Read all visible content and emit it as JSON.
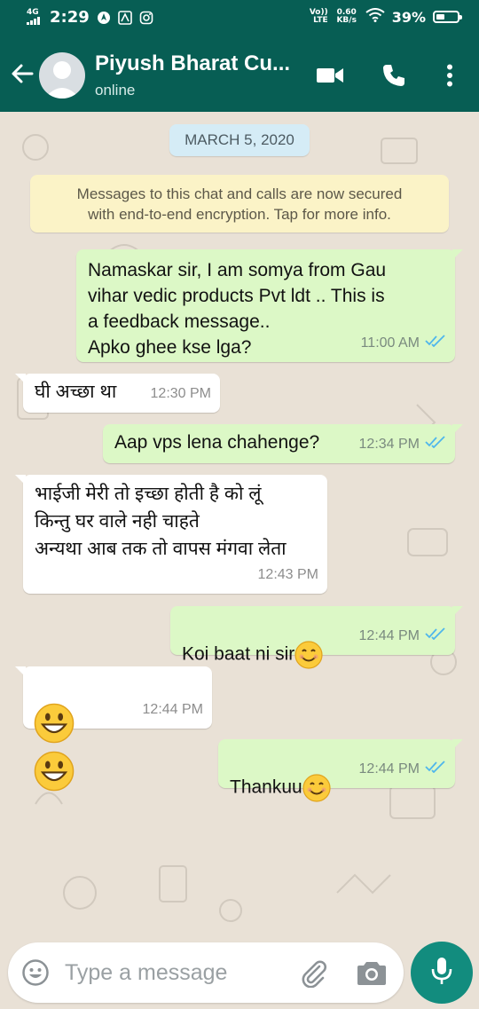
{
  "status_bar": {
    "network": "4G",
    "time": "2:29",
    "carrier": "Vo)) LTE",
    "speed": "0.60 KB/s",
    "battery_percent": "39%",
    "battery_level": 0.39
  },
  "header": {
    "contact_name": "Piyush Bharat Cu...",
    "status": "online",
    "icons": [
      "back-arrow-icon",
      "avatar",
      "video-call-icon",
      "phone-icon",
      "more-options-icon"
    ]
  },
  "chat": {
    "date_label": "MARCH 5, 2020",
    "encryption_notice": "Messages to this chat and calls are now secured\nwith end-to-end encryption. Tap for more info.",
    "messages": [
      {
        "direction": "out",
        "text": "Namaskar sir, I am somya from Gau\nvihar vedic products Pvt ldt .. This is\na feedback message..\nApko ghee kse lga?",
        "time": "11:00 AM",
        "read": true
      },
      {
        "direction": "in",
        "text": "घी अच्छा था",
        "time": "12:30 PM"
      },
      {
        "direction": "out",
        "text": "Aap vps lena chahenge?",
        "time": "12:34 PM",
        "read": true
      },
      {
        "direction": "in",
        "text": "भाईजी मेरी तो इच्छा होती है को लूं\nकिन्तु घर वाले नही चाहते\nअन्यथा आब तक तो वापस मंगवा लेता",
        "time": "12:43 PM"
      },
      {
        "direction": "out",
        "text": "Koi baat ni sir",
        "emoji": "smiling-face",
        "time": "12:44 PM",
        "read": true
      },
      {
        "direction": "in",
        "text": "",
        "emoji": "grinning-face x2",
        "time": "12:44 PM"
      },
      {
        "direction": "out",
        "text": "Thankuu",
        "emoji": "smiling-face",
        "time": "12:44 PM",
        "read": true
      }
    ]
  },
  "composer": {
    "placeholder": "Type a message"
  },
  "colors": {
    "header": "#075e54",
    "outgoing_bubble": "#dcf8c6",
    "incoming_bubble": "#ffffff",
    "read_ticks": "#4fb6ec",
    "mic_button": "#128c7e"
  }
}
